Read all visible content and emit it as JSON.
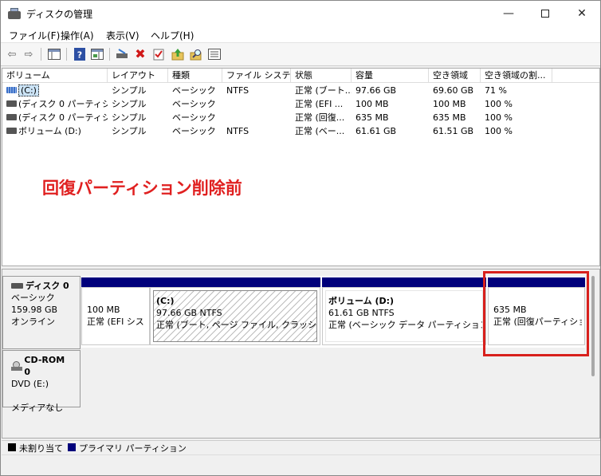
{
  "window": {
    "title": "ディスクの管理",
    "minimize": "—",
    "close": "✕"
  },
  "menu": [
    "ファイル(F)",
    "操作(A)",
    "表示(V)",
    "ヘルプ(H)"
  ],
  "toolbar": {
    "back": "⇦",
    "forward": "⇨",
    "close": "✖"
  },
  "list": {
    "columns": [
      "ボリューム",
      "レイアウト",
      "種類",
      "ファイル システム",
      "状態",
      "容量",
      "空き領域",
      "空き領域の割..."
    ],
    "rows": [
      {
        "volume": "(C:)",
        "layout": "シンプル",
        "type": "ベーシック",
        "fs": "NTFS",
        "status": "正常 (ブート...",
        "capacity": "97.66 GB",
        "free": "69.60 GB",
        "pct": "71 %"
      },
      {
        "volume": "(ディスク 0 パーティシ...",
        "layout": "シンプル",
        "type": "ベーシック",
        "fs": "",
        "status": "正常 (EFI ...",
        "capacity": "100 MB",
        "free": "100 MB",
        "pct": "100 %"
      },
      {
        "volume": "(ディスク 0 パーティシ...",
        "layout": "シンプル",
        "type": "ベーシック",
        "fs": "",
        "status": "正常 (回復...",
        "capacity": "635 MB",
        "free": "635 MB",
        "pct": "100 %"
      },
      {
        "volume": "ボリューム (D:)",
        "layout": "シンプル",
        "type": "ベーシック",
        "fs": "NTFS",
        "status": "正常 (ベー...",
        "capacity": "61.61 GB",
        "free": "61.51 GB",
        "pct": "100 %"
      }
    ]
  },
  "annotation": "回復パーティション削除前",
  "disk0": {
    "name": "ディスク 0",
    "type": "ベーシック",
    "size": "159.98 GB",
    "status": "オンライン",
    "partitions": [
      {
        "line1": "100 MB",
        "line2": "正常 (EFI シス"
      },
      {
        "name": "(C:)",
        "line1": "97.66 GB NTFS",
        "line2": "正常 (ブート, ページ ファイル, クラッシュ ダンプ"
      },
      {
        "name": "ボリューム (D:)",
        "line1": "61.61 GB NTFS",
        "line2": "正常 (ベーシック データ パーティション)"
      },
      {
        "line1": "635 MB",
        "line2": "正常 (回復パーティショ"
      }
    ]
  },
  "cdrom": {
    "name": "CD-ROM 0",
    "drive": "DVD (E:)",
    "status": "メディアなし"
  },
  "legend": {
    "unallocated": "未割り当て",
    "primary": "プライマリ パーティション",
    "colors": {
      "unallocated": "#000000",
      "primary": "#00007b"
    }
  },
  "colors": {
    "annotation": "#e02020",
    "highlight_box": "#d8201c",
    "partition_bar": "#00007b"
  }
}
